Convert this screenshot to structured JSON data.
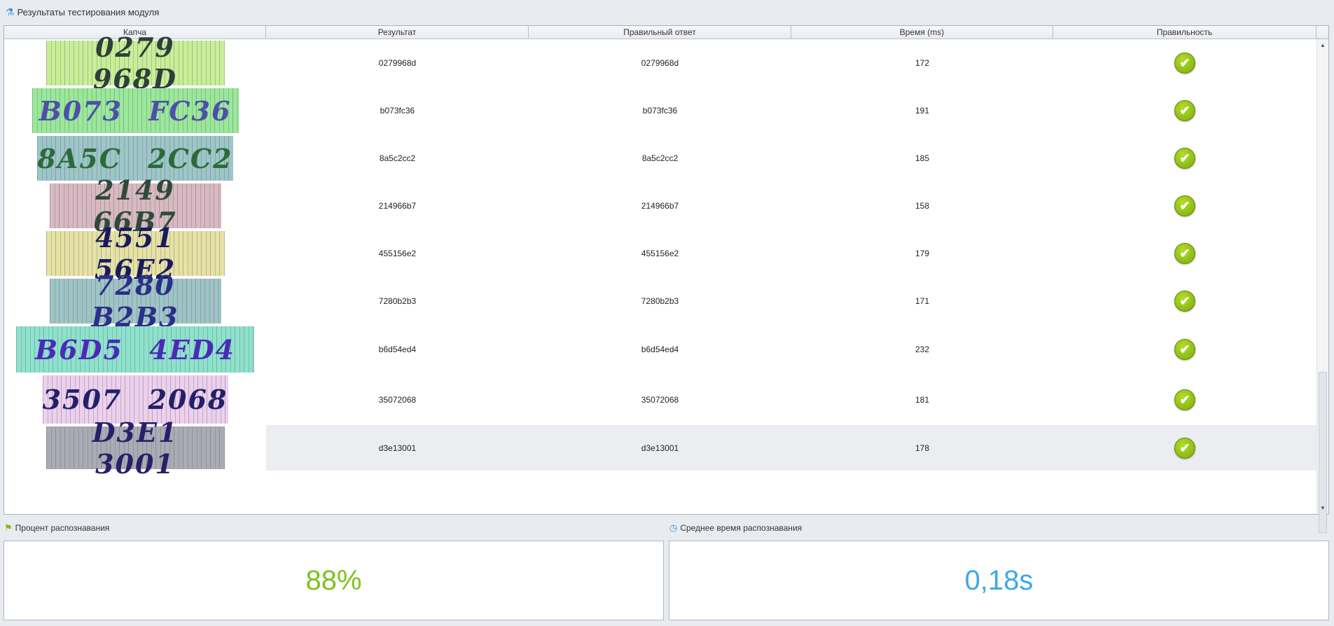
{
  "title": "Результаты тестирования модуля",
  "columns": [
    "Капча",
    "Результат",
    "Правильный ответ",
    "Время (ms)",
    "Правильность"
  ],
  "rows": [
    {
      "captcha": "0279 968D",
      "result": "0279968d",
      "answer": "0279968d",
      "time": "172",
      "bg": "#c8ef98",
      "fg": "#2f3f3a"
    },
    {
      "captcha": "B073 FC36",
      "result": "b073fc36",
      "answer": "b073fc36",
      "time": "191",
      "bg": "#9ae89a",
      "fg": "#4e4fa8"
    },
    {
      "captcha": "8A5C 2CC2",
      "result": "8a5c2cc2",
      "answer": "8a5c2cc2",
      "time": "185",
      "bg": "#9dc6c8",
      "fg": "#2d6a3a"
    },
    {
      "captcha": "2149 66B7",
      "result": "214966b7",
      "answer": "214966b7",
      "time": "158",
      "bg": "#d8b9c2",
      "fg": "#2f4a3a"
    },
    {
      "captcha": "4551 56E2",
      "result": "455156e2",
      "answer": "455156e2",
      "time": "179",
      "bg": "#e6e2a4",
      "fg": "#1a1a60"
    },
    {
      "captcha": "7280 B2B3",
      "result": "7280b2b3",
      "answer": "7280b2b3",
      "time": "171",
      "bg": "#9fc4c6",
      "fg": "#2b2f8a"
    },
    {
      "captcha": "B6D5 4ED4",
      "result": "b6d54ed4",
      "answer": "b6d54ed4",
      "time": "232",
      "bg": "#8ee2cc",
      "fg": "#4a2ab8"
    },
    {
      "captcha": "3507 2068",
      "result": "35072068",
      "answer": "35072068",
      "time": "181",
      "bg": "#ecd0ec",
      "fg": "#22206a"
    },
    {
      "captcha": "D3E1 3001",
      "result": "d3e13001",
      "answer": "d3e13001",
      "time": "178",
      "bg": "#a9acb4",
      "fg": "#2a1f6a"
    }
  ],
  "recognition_label": "Процент распознавания",
  "recognition_value": "88%",
  "avg_time_label": "Среднее время распознавания",
  "avg_time_value": "0,18s",
  "colors": {
    "percent": "#7dc21e",
    "time": "#3ea8e6"
  }
}
